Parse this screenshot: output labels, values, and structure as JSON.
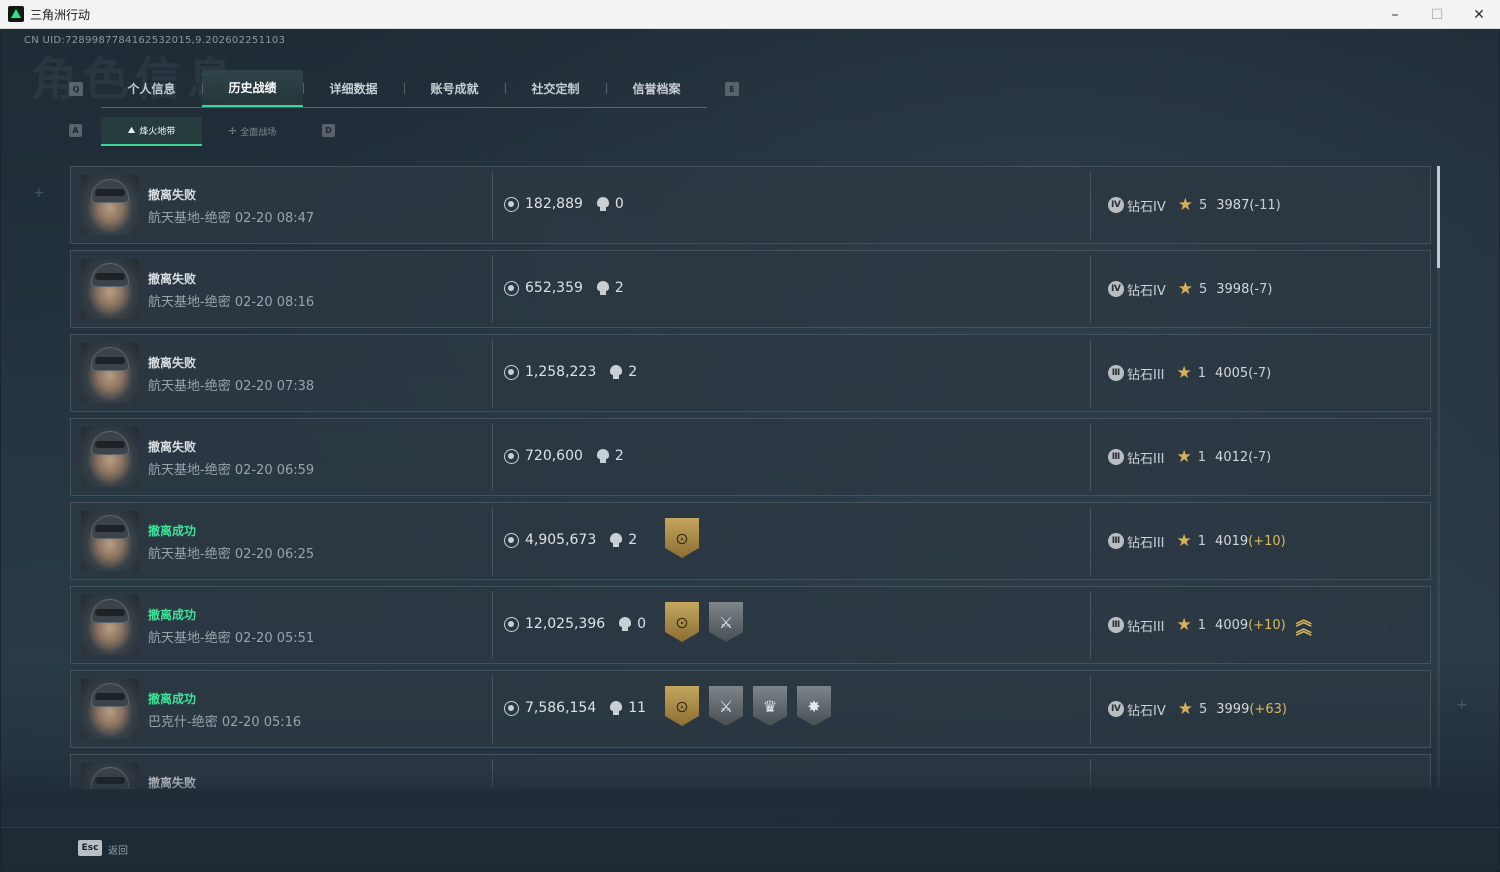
{
  "window": {
    "title": "三角洲行动"
  },
  "uid_text": "CN UID:7289987784162532015,9.202602251103",
  "watermark": "角色信息",
  "tab_keys": {
    "left": "Q",
    "right": "E"
  },
  "tabs": [
    "个人信息",
    "历史战绩",
    "详细数据",
    "账号成就",
    "社交定制",
    "信誉档案"
  ],
  "active_tab": 1,
  "subtab_keys": {
    "left": "A",
    "right": "D"
  },
  "subtabs": [
    "烽火地带",
    "全面战场"
  ],
  "active_subtab": 0,
  "records": [
    {
      "result": "撤离失败",
      "success": false,
      "map": "航天基地-绝密 02-20 08:47",
      "value": "182,889",
      "kills": "0",
      "badges": [],
      "rank_icon": "Ⅳ",
      "rank": "钻石IV",
      "stars": "5",
      "score": "3987",
      "delta": "(-11)",
      "delta_positive": false,
      "promo": ""
    },
    {
      "result": "撤离失败",
      "success": false,
      "map": "航天基地-绝密 02-20 08:16",
      "value": "652,359",
      "kills": "2",
      "badges": [],
      "rank_icon": "Ⅳ",
      "rank": "钻石IV",
      "stars": "5",
      "score": "3998",
      "delta": "(-7)",
      "delta_positive": false,
      "promo": ""
    },
    {
      "result": "撤离失败",
      "success": false,
      "map": "航天基地-绝密 02-20 07:38",
      "value": "1,258,223",
      "kills": "2",
      "badges": [],
      "rank_icon": "Ⅲ",
      "rank": "钻石III",
      "stars": "1",
      "score": "4005",
      "delta": "(-7)",
      "delta_positive": false,
      "promo": ""
    },
    {
      "result": "撤离失败",
      "success": false,
      "map": "航天基地-绝密 02-20 06:59",
      "value": "720,600",
      "kills": "2",
      "badges": [],
      "rank_icon": "Ⅲ",
      "rank": "钻石III",
      "stars": "1",
      "score": "4012",
      "delta": "(-7)",
      "delta_positive": false,
      "promo": ""
    },
    {
      "result": "撤离成功",
      "success": true,
      "map": "航天基地-绝密 02-20 06:25",
      "value": "4,905,673",
      "kills": "2",
      "badges": [
        "gold"
      ],
      "rank_icon": "Ⅲ",
      "rank": "钻石III",
      "stars": "1",
      "score": "4019",
      "delta": "(+10)",
      "delta_positive": true,
      "promo": ""
    },
    {
      "result": "撤离成功",
      "success": true,
      "map": "航天基地-绝密 02-20 05:51",
      "value": "12,025,396",
      "kills": "0",
      "badges": [
        "gold",
        "grey"
      ],
      "rank_icon": "Ⅲ",
      "rank": "钻石III",
      "stars": "1",
      "score": "4009",
      "delta": "(+10)",
      "delta_positive": true,
      "promo": "rank-up"
    },
    {
      "result": "撤离成功",
      "success": true,
      "map": "巴克什-绝密 02-20 05:16",
      "value": "7,586,154",
      "kills": "11",
      "badges": [
        "gold",
        "grey",
        "grey",
        "grey"
      ],
      "rank_icon": "Ⅳ",
      "rank": "钻石IV",
      "stars": "5",
      "score": "3999",
      "delta": "(+63)",
      "delta_positive": true,
      "promo": ""
    },
    {
      "result": "撤离失败",
      "success": false,
      "map": "",
      "value": "",
      "kills": "",
      "badges": [],
      "rank_icon": "",
      "rank": "",
      "stars": "",
      "score": "",
      "delta": "",
      "delta_positive": false,
      "promo": ""
    }
  ],
  "footer": {
    "esc_key": "Esc",
    "back_label": "返回"
  },
  "colors": {
    "accent": "#3fd39a",
    "success": "#3fe09a",
    "gold": "#d9b860"
  }
}
